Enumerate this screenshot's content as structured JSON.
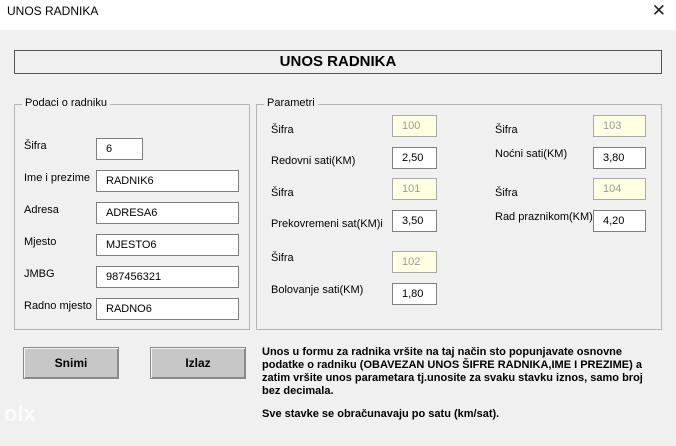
{
  "window": {
    "title": "UNOS RADNIKA",
    "close_glyph": "✕"
  },
  "form": {
    "title": "UNOS RADNIKA"
  },
  "podaci": {
    "legend": "Podaci o radniku",
    "sifra": {
      "label": "Šifra",
      "value": "6"
    },
    "ime": {
      "label": "Ime i prezime",
      "value": "RADNIK6"
    },
    "adresa": {
      "label": "Adresa",
      "value": "ADRESA6"
    },
    "mjesto": {
      "label": "Mjesto",
      "value": "MJESTO6"
    },
    "jmbg": {
      "label": "JMBG",
      "value": "987456321"
    },
    "radno_mjesto": {
      "label": "Radno mjesto",
      "value": "RADNO6"
    }
  },
  "parametri": {
    "legend": "Parametri",
    "redovni": {
      "sifra_label": "Šifra",
      "sifra_value": "100",
      "label": "Redovni sati(KM)",
      "value": "2,50"
    },
    "prekovremeni": {
      "sifra_label": "Šifra",
      "sifra_value": "101",
      "label": "Prekovremeni  sat(KM)i",
      "value": "3,50"
    },
    "bolovanje": {
      "sifra_label": "Šifra",
      "sifra_value": "102",
      "label": "Bolovanje sati(KM)",
      "value": "1,80"
    },
    "nocni": {
      "sifra_label": "Šifra",
      "sifra_value": "103",
      "label": "Noćni sati(KM)",
      "value": "3,80"
    },
    "praznik": {
      "sifra_label": "Šifra",
      "sifra_value": "104",
      "label": "Rad praznikom(KM)",
      "value": "4,20"
    }
  },
  "buttons": {
    "snimi": "Snimi",
    "izlaz": "Izlaz"
  },
  "info": {
    "line1": "Unos u formu za radnika vršite na taj način sto popunjavate osnovne podatke o radniku (OBAVEZAN UNOS ŠIFRE RADNIKA,IME I PREZIME) a zatim vršite unos parametara tj.unosite za svaku stavku iznos, samo broj bez decimala.",
    "line2": "Sve stavke se obračunavaju po satu (km/sat)."
  },
  "watermark": {
    "text": "olx"
  }
}
